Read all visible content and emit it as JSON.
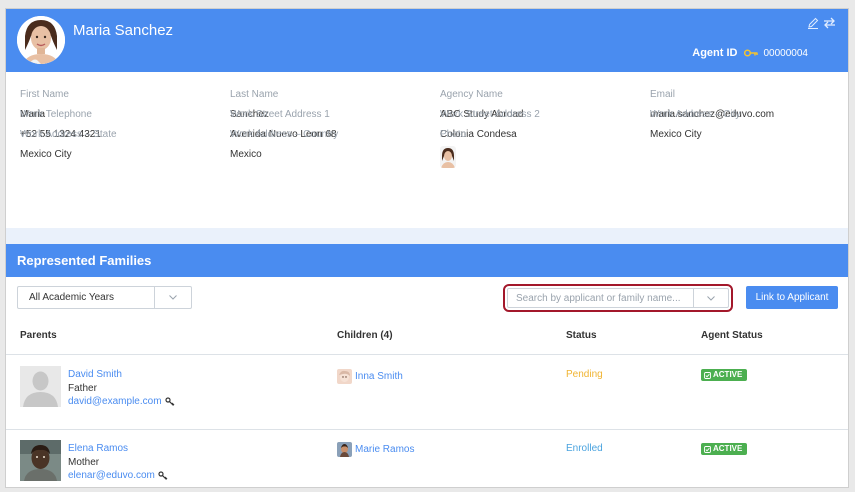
{
  "agent": {
    "name": "Maria Sanchez",
    "id_label": "Agent ID",
    "id_value": "00000004"
  },
  "details": [
    {
      "label": "First Name",
      "value": "Maria"
    },
    {
      "label": "Last Name",
      "value": "Sanchez"
    },
    {
      "label": "Agency Name",
      "value": "ABC Study Abroad"
    },
    {
      "label": "Email",
      "value": "maria.sanchez@eduvo.com"
    },
    {
      "label": "Work Telephone",
      "value": "+52 55 1324 4321"
    },
    {
      "label": "Work Street Address 1",
      "value": "Avenida Nuevo Leon 68"
    },
    {
      "label": "Work Street Address 2",
      "value": "Colonia Condesa"
    },
    {
      "label": "Work Address – City",
      "value": "Mexico City"
    },
    {
      "label": "Work Address – State",
      "value": "Mexico City"
    },
    {
      "label": "Work Address – Country",
      "value": "Mexico"
    },
    {
      "label": "Photo",
      "value": ""
    }
  ],
  "families": {
    "title": "Represented Families",
    "year_filter": "All Academic Years",
    "search_placeholder": "Search by applicant or family name...",
    "link_button": "Link to Applicant",
    "columns": {
      "parents": "Parents",
      "children": "Children (4)",
      "status": "Status",
      "agent_status": "Agent Status"
    },
    "rows": [
      {
        "parent_name": "David Smith",
        "relation": "Father",
        "email": "david@example.com",
        "child": "Inna Smith",
        "status": "Pending",
        "status_color": "#f0b432",
        "agent_status": "ACTIVE"
      },
      {
        "parent_name": "Elena Ramos",
        "relation": "Mother",
        "email": "elenar@eduvo.com",
        "child": "Marie Ramos",
        "status": "Enrolled",
        "status_color": "#4aa3df",
        "agent_status": "ACTIVE"
      }
    ]
  },
  "colors": {
    "primary": "#4a8cf0",
    "active_badge": "#4caf50",
    "highlight": "#a3182b"
  }
}
